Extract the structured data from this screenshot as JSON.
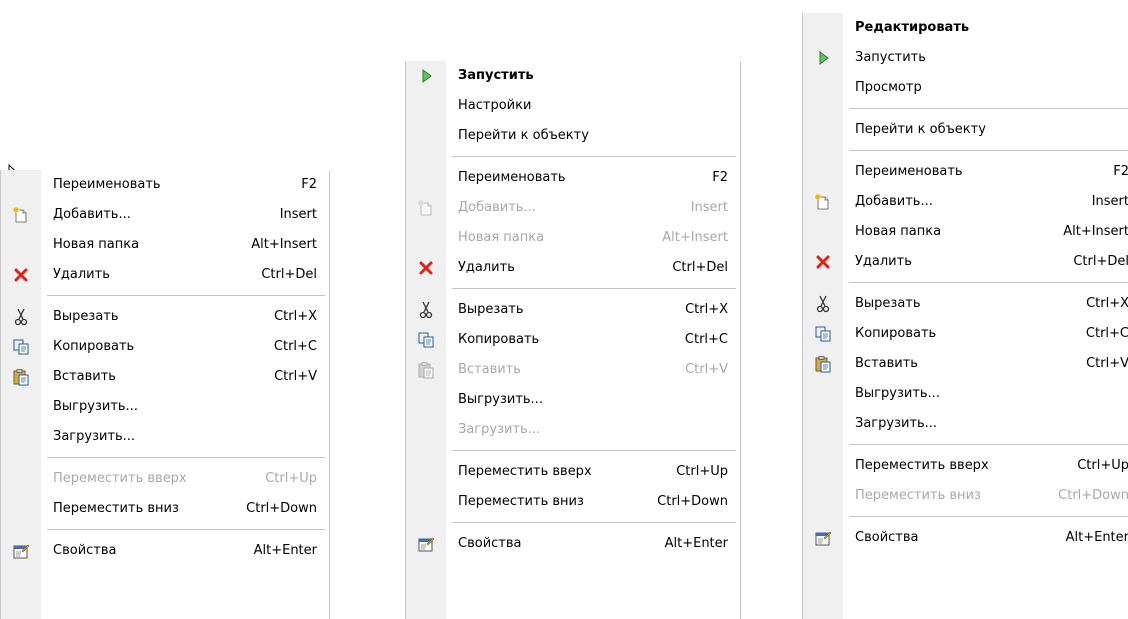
{
  "menus": [
    {
      "id": "menu1",
      "items": [
        {
          "type": "item",
          "label": "Переименовать",
          "shortcut": "F2",
          "icon": "",
          "disabled": false,
          "bold": false
        },
        {
          "type": "item",
          "label": "Добавить...",
          "shortcut": "Insert",
          "icon": "new-item-icon",
          "disabled": false,
          "bold": false
        },
        {
          "type": "item",
          "label": "Новая папка",
          "shortcut": "Alt+Insert",
          "icon": "",
          "disabled": false,
          "bold": false
        },
        {
          "type": "item",
          "label": "Удалить",
          "shortcut": "Ctrl+Del",
          "icon": "delete-icon",
          "disabled": false,
          "bold": false
        },
        {
          "type": "separator"
        },
        {
          "type": "item",
          "label": "Вырезать",
          "shortcut": "Ctrl+X",
          "icon": "cut-icon",
          "disabled": false,
          "bold": false
        },
        {
          "type": "item",
          "label": "Копировать",
          "shortcut": "Ctrl+C",
          "icon": "copy-icon",
          "disabled": false,
          "bold": false
        },
        {
          "type": "item",
          "label": "Вставить",
          "shortcut": "Ctrl+V",
          "icon": "paste-icon",
          "disabled": false,
          "bold": false
        },
        {
          "type": "item",
          "label": "Выгрузить...",
          "shortcut": "",
          "icon": "",
          "disabled": false,
          "bold": false
        },
        {
          "type": "item",
          "label": "Загрузить...",
          "shortcut": "",
          "icon": "",
          "disabled": false,
          "bold": false
        },
        {
          "type": "separator"
        },
        {
          "type": "item",
          "label": "Переместить вверх",
          "shortcut": "Ctrl+Up",
          "icon": "",
          "disabled": true,
          "bold": false
        },
        {
          "type": "item",
          "label": "Переместить вниз",
          "shortcut": "Ctrl+Down",
          "icon": "",
          "disabled": false,
          "bold": false
        },
        {
          "type": "separator"
        },
        {
          "type": "item",
          "label": "Свойства",
          "shortcut": "Alt+Enter",
          "icon": "properties-icon",
          "disabled": false,
          "bold": false
        }
      ]
    },
    {
      "id": "menu2",
      "items": [
        {
          "type": "item",
          "label": "Запустить",
          "shortcut": "",
          "icon": "run-icon",
          "disabled": false,
          "bold": true
        },
        {
          "type": "item",
          "label": "Настройки",
          "shortcut": "",
          "icon": "",
          "disabled": false,
          "bold": false
        },
        {
          "type": "item",
          "label": "Перейти к объекту",
          "shortcut": "",
          "icon": "",
          "disabled": false,
          "bold": false
        },
        {
          "type": "separator"
        },
        {
          "type": "item",
          "label": "Переименовать",
          "shortcut": "F2",
          "icon": "",
          "disabled": false,
          "bold": false
        },
        {
          "type": "item",
          "label": "Добавить...",
          "shortcut": "Insert",
          "icon": "new-item-icon",
          "disabled": true,
          "bold": false
        },
        {
          "type": "item",
          "label": "Новая папка",
          "shortcut": "Alt+Insert",
          "icon": "",
          "disabled": true,
          "bold": false
        },
        {
          "type": "item",
          "label": "Удалить",
          "shortcut": "Ctrl+Del",
          "icon": "delete-icon",
          "disabled": false,
          "bold": false
        },
        {
          "type": "separator"
        },
        {
          "type": "item",
          "label": "Вырезать",
          "shortcut": "Ctrl+X",
          "icon": "cut-icon",
          "disabled": false,
          "bold": false
        },
        {
          "type": "item",
          "label": "Копировать",
          "shortcut": "Ctrl+C",
          "icon": "copy-icon",
          "disabled": false,
          "bold": false
        },
        {
          "type": "item",
          "label": "Вставить",
          "shortcut": "Ctrl+V",
          "icon": "paste-icon",
          "disabled": true,
          "bold": false
        },
        {
          "type": "item",
          "label": "Выгрузить...",
          "shortcut": "",
          "icon": "",
          "disabled": false,
          "bold": false
        },
        {
          "type": "item",
          "label": "Загрузить...",
          "shortcut": "",
          "icon": "",
          "disabled": true,
          "bold": false
        },
        {
          "type": "separator"
        },
        {
          "type": "item",
          "label": "Переместить вверх",
          "shortcut": "Ctrl+Up",
          "icon": "",
          "disabled": false,
          "bold": false
        },
        {
          "type": "item",
          "label": "Переместить вниз",
          "shortcut": "Ctrl+Down",
          "icon": "",
          "disabled": false,
          "bold": false
        },
        {
          "type": "separator"
        },
        {
          "type": "item",
          "label": "Свойства",
          "shortcut": "Alt+Enter",
          "icon": "properties-icon",
          "disabled": false,
          "bold": false
        }
      ]
    },
    {
      "id": "menu3",
      "items": [
        {
          "type": "item",
          "label": "Редактировать",
          "shortcut": "",
          "icon": "",
          "disabled": false,
          "bold": true
        },
        {
          "type": "item",
          "label": "Запустить",
          "shortcut": "",
          "icon": "run-icon",
          "disabled": false,
          "bold": false
        },
        {
          "type": "item",
          "label": "Просмотр",
          "shortcut": "",
          "icon": "",
          "disabled": false,
          "bold": false
        },
        {
          "type": "separator"
        },
        {
          "type": "item",
          "label": "Перейти к объекту",
          "shortcut": "",
          "icon": "",
          "disabled": false,
          "bold": false
        },
        {
          "type": "separator"
        },
        {
          "type": "item",
          "label": "Переименовать",
          "shortcut": "F2",
          "icon": "",
          "disabled": false,
          "bold": false
        },
        {
          "type": "item",
          "label": "Добавить...",
          "shortcut": "Insert",
          "icon": "new-item-icon",
          "disabled": false,
          "bold": false
        },
        {
          "type": "item",
          "label": "Новая папка",
          "shortcut": "Alt+Insert",
          "icon": "",
          "disabled": false,
          "bold": false
        },
        {
          "type": "item",
          "label": "Удалить",
          "shortcut": "Ctrl+Del",
          "icon": "delete-icon",
          "disabled": false,
          "bold": false
        },
        {
          "type": "separator"
        },
        {
          "type": "item",
          "label": "Вырезать",
          "shortcut": "Ctrl+X",
          "icon": "cut-icon",
          "disabled": false,
          "bold": false
        },
        {
          "type": "item",
          "label": "Копировать",
          "shortcut": "Ctrl+C",
          "icon": "copy-icon",
          "disabled": false,
          "bold": false
        },
        {
          "type": "item",
          "label": "Вставить",
          "shortcut": "Ctrl+V",
          "icon": "paste-icon",
          "disabled": false,
          "bold": false
        },
        {
          "type": "item",
          "label": "Выгрузить...",
          "shortcut": "",
          "icon": "",
          "disabled": false,
          "bold": false
        },
        {
          "type": "item",
          "label": "Загрузить...",
          "shortcut": "",
          "icon": "",
          "disabled": false,
          "bold": false
        },
        {
          "type": "separator"
        },
        {
          "type": "item",
          "label": "Переместить вверх",
          "shortcut": "Ctrl+Up",
          "icon": "",
          "disabled": false,
          "bold": false
        },
        {
          "type": "item",
          "label": "Переместить вниз",
          "shortcut": "Ctrl+Down",
          "icon": "",
          "disabled": true,
          "bold": false
        },
        {
          "type": "separator"
        },
        {
          "type": "item",
          "label": "Свойства",
          "shortcut": "Alt+Enter",
          "icon": "properties-icon",
          "disabled": false,
          "bold": false
        }
      ]
    }
  ],
  "colors": {
    "disabled_text": "#a8a8a8",
    "gutter": "#f0f0f0",
    "delete_red": "#e0201a",
    "run_green": "#3aa83a"
  }
}
